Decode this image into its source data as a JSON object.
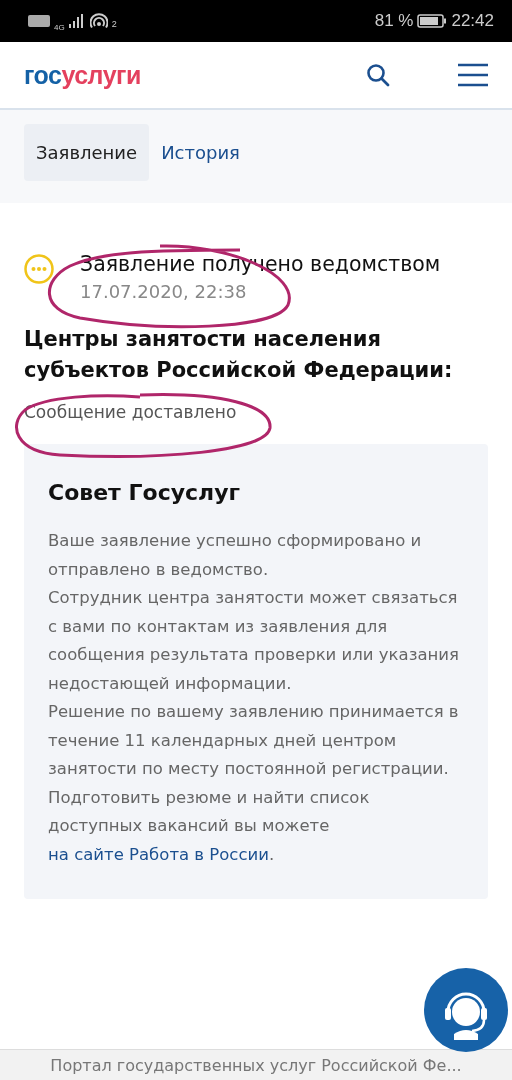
{
  "status_bar": {
    "network": "4G",
    "hotspot_count": "2",
    "battery": "81 %",
    "time": "22:42"
  },
  "header": {
    "logo_first": "гос",
    "logo_second": "услуги"
  },
  "tabs": [
    {
      "label": "Заявление",
      "selected": true
    },
    {
      "label": "История",
      "selected": false
    }
  ],
  "event": {
    "title": "Заявление получено ведомством",
    "date": "17.07.2020, 22:38"
  },
  "department": {
    "name": "Центры занятости населения субъектов Российской Федерации:",
    "message": "Сообщение доставлено"
  },
  "advice": {
    "title": "Совет Госуслуг",
    "paragraphs": [
      {
        "text": "Ваше заявление успешно сформировано и отправлено в ведомство."
      },
      {
        "text": "Сотрудник центра занятости может связаться с вами по контактам из заявления для сообщения результата проверки или указания недостающей информации."
      },
      {
        "text": "Решение по вашему заявлению принимается в течение 11 календарных дней центром занятости по месту постоянной регистрации."
      },
      {
        "text": "Подготовить резюме и найти список доступных вакансий вы можете ",
        "link": "на сайте Работа в России",
        "after": "."
      }
    ]
  },
  "footer": {
    "title": "Портал государственных услуг Российской Фе..."
  }
}
